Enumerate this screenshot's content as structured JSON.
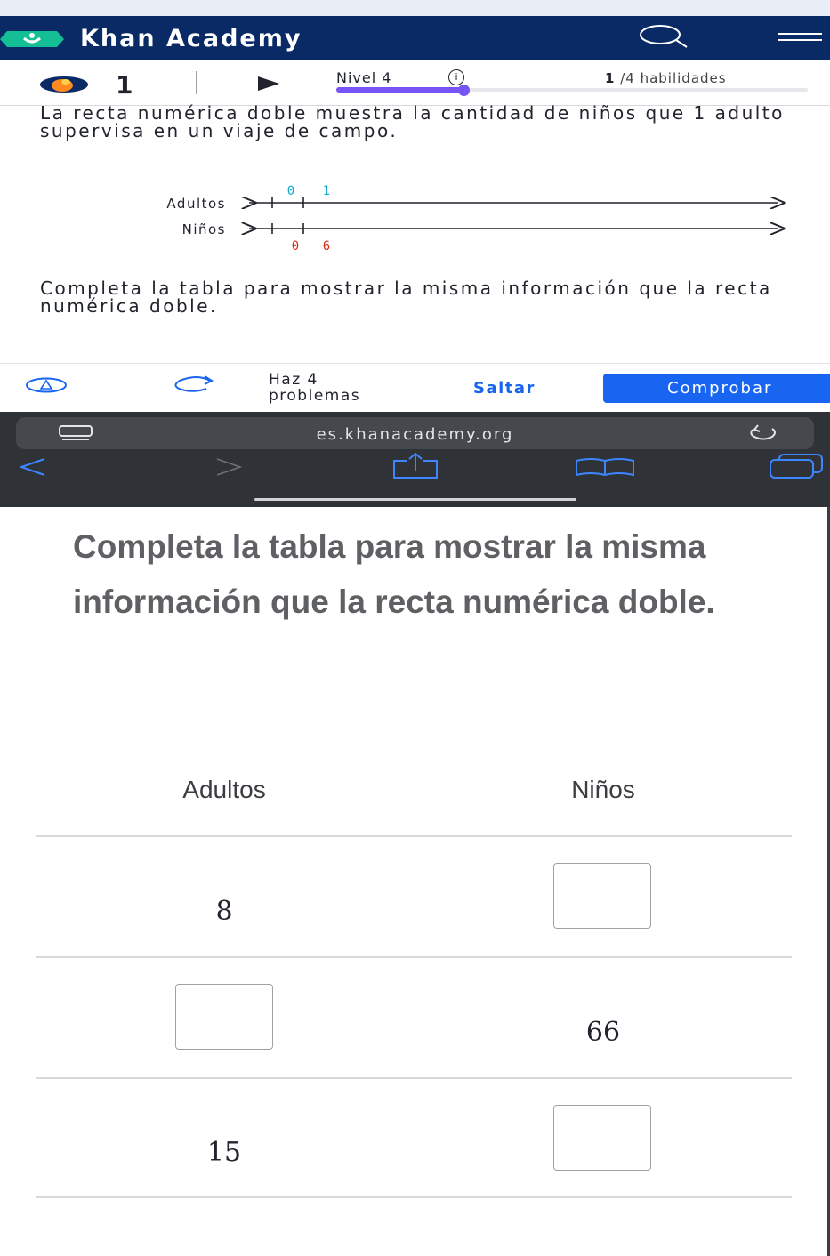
{
  "header": {
    "brand": "Khan Academy"
  },
  "progress": {
    "streak_count": "1",
    "level_label": "Nivel 4",
    "info_glyph": "i",
    "skills_done": "1",
    "skills_rest": "/4 habilidades",
    "level_progress_fraction": 0.27
  },
  "question": {
    "prompt_line1": "La recta numérica doble muestra la cantidad de niños que 1 adulto supervisa en un viaje de campo.",
    "prompt_line2": "Completa la tabla para mostrar la misma información que la recta numérica doble."
  },
  "numberline": {
    "top_label": "Adultos",
    "bottom_label": "Niños",
    "top_ticks": [
      "0",
      "1"
    ],
    "bottom_ticks": [
      "0",
      "6"
    ]
  },
  "actions": {
    "problems_label_line1": "Haz 4",
    "problems_label_line2": "problemas",
    "skip_label": "Saltar",
    "check_label": "Comprobar"
  },
  "browser": {
    "url": "es.khanacademy.org"
  },
  "zoom": {
    "title": "Completa la tabla para mostrar la misma información que la recta numérica doble.",
    "table": {
      "headers": [
        "Adultos",
        "Niños"
      ],
      "rows": [
        {
          "adults": "8",
          "children": ""
        },
        {
          "adults": "",
          "children": "66"
        },
        {
          "adults": "15",
          "children": ""
        }
      ]
    }
  },
  "colors": {
    "header_bg": "#0a2a66",
    "accent_blue": "#1865f2",
    "progress_purple": "#7854f7",
    "tick_teal": "#11accd",
    "tick_red": "#d92916"
  },
  "icons": [
    "logo-icon",
    "search-icon",
    "menu-icon",
    "streak-icon",
    "play-icon",
    "info-icon",
    "hint-icon",
    "redo-icon",
    "reader-icon",
    "reload-icon",
    "back-icon",
    "forward-icon",
    "share-icon",
    "bookmarks-icon",
    "tabs-icon"
  ]
}
